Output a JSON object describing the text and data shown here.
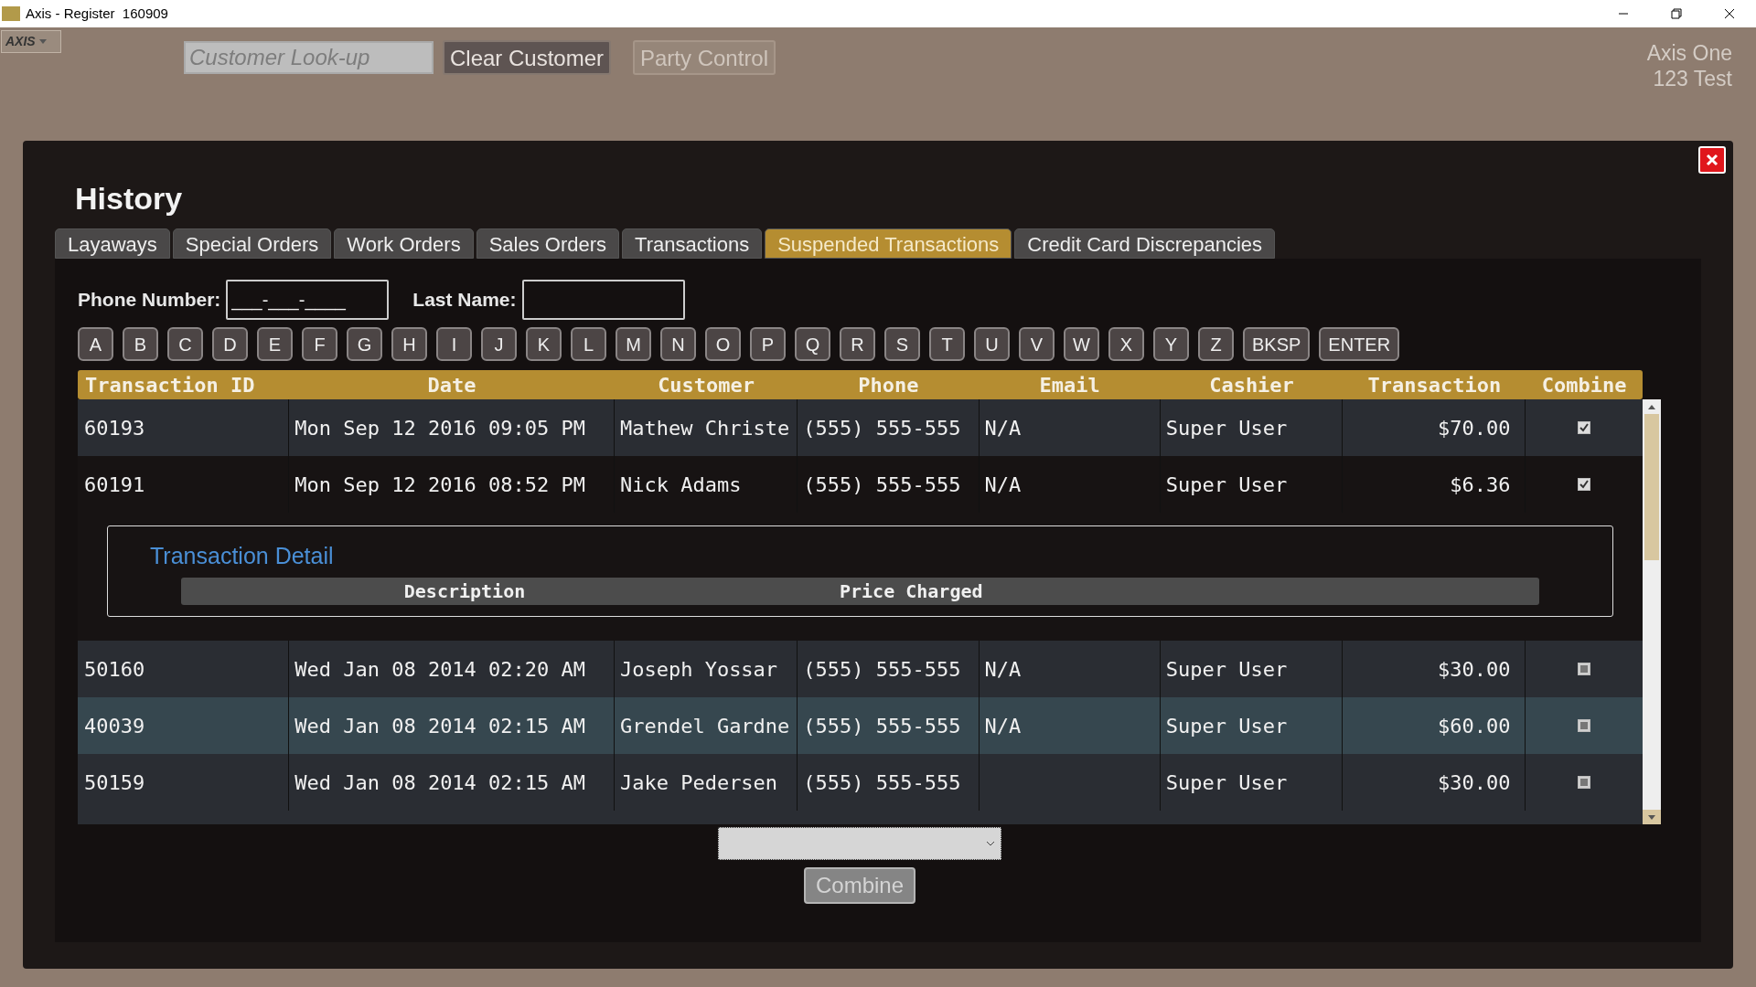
{
  "window": {
    "title": "Axis - Register  160909",
    "logo": "AXIS"
  },
  "top_bar": {
    "customer_lookup": {
      "placeholder": "Customer Look-up"
    },
    "buttons": [
      {
        "label": "Clear Customer",
        "disabled": false
      },
      {
        "label": "Party Control",
        "disabled": true
      }
    ],
    "store": [
      "Axis One",
      "123 Test"
    ]
  },
  "dialog": {
    "title": "History",
    "tabs": [
      {
        "label": "Layaways",
        "selected": false
      },
      {
        "label": "Special Orders",
        "selected": false
      },
      {
        "label": "Work Orders",
        "selected": false
      },
      {
        "label": "Sales Orders",
        "selected": false
      },
      {
        "label": "Transactions",
        "selected": false
      },
      {
        "label": "Suspended Transactions",
        "selected": true
      },
      {
        "label": "Credit Card Discrepancies",
        "selected": false
      }
    ],
    "phone": {
      "label": "Phone Number:",
      "value": "___-___-____"
    },
    "last_name": {
      "label": "Last Name:"
    },
    "keys": [
      "A",
      "B",
      "C",
      "D",
      "E",
      "F",
      "G",
      "H",
      "I",
      "J",
      "K",
      "L",
      "M",
      "N",
      "O",
      "P",
      "Q",
      "R",
      "S",
      "T",
      "U",
      "V",
      "W",
      "X",
      "Y",
      "Z",
      "BKSP",
      "ENTER"
    ],
    "table": {
      "columns": [
        "Transaction ID",
        "Date",
        "Customer",
        "Phone",
        "Email",
        "Cashier",
        "Transaction",
        "Combine"
      ],
      "rows": [
        {
          "cells": [
            "60193",
            "Mon Sep 12 2016 09:05 PM",
            "Mathew Christe",
            "(555) 555-555",
            "N/A",
            "Super User",
            "$70.00"
          ],
          "checked": true,
          "selected": false,
          "expanded": false
        },
        {
          "cells": [
            "60191",
            "Mon Sep 12 2016 08:52 PM",
            "Nick Adams",
            "(555) 555-555",
            "N/A",
            "Super User",
            "$6.36"
          ],
          "checked": true,
          "selected": false,
          "expanded": true
        },
        {
          "cells": [
            "50160",
            "Wed Jan 08 2014 02:20 AM",
            "Joseph Yossar",
            "(555) 555-555",
            "N/A",
            "Super User",
            "$30.00"
          ],
          "checked": false,
          "selected": false,
          "expanded": false
        },
        {
          "cells": [
            "40039",
            "Wed Jan 08 2014 02:15 AM",
            "Grendel Gardne",
            "(555) 555-555",
            "N/A",
            "Super User",
            "$60.00"
          ],
          "checked": false,
          "selected": true,
          "expanded": false
        },
        {
          "cells": [
            "50159",
            "Wed Jan 08 2014 02:15 AM",
            "Jake Pedersen",
            "(555) 555-555",
            "",
            "Super User",
            "$30.00"
          ],
          "checked": false,
          "selected": false,
          "expanded": false
        }
      ]
    },
    "detail": {
      "title": "Transaction Detail",
      "columns": [
        "Description",
        "Price Charged"
      ]
    },
    "combine_button": {
      "label": "Combine",
      "disabled": true
    }
  }
}
